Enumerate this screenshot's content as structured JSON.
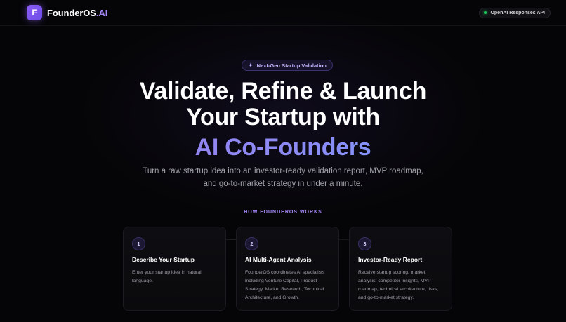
{
  "header": {
    "logo_letter": "F",
    "brand_main": "FounderOS",
    "brand_suffix": ".AI",
    "api_badge": "OpenAI Responses API",
    "status_color": "#22c55e"
  },
  "hero": {
    "pill_label": "Next-Gen Startup Validation",
    "pill_icon": "sparkles-icon",
    "headline_line1": "Validate, Refine & Launch",
    "headline_line2": "Your Startup with",
    "headline_highlight": "AI Co-Founders",
    "subtitle": "Turn a raw startup idea into an investor-ready validation report, MVP roadmap, and go-to-market strategy in under a minute."
  },
  "how_it_works": {
    "label": "HOW FOUNDEROS WORKS",
    "steps": [
      {
        "number": "1",
        "title": "Describe Your Startup",
        "description": "Enter your startup idea in natural language."
      },
      {
        "number": "2",
        "title": "AI Multi-Agent Analysis",
        "description": "FounderOS coordinates AI specialists including Venture Capital, Product Strategy, Market Research, Technical Architecture, and Growth."
      },
      {
        "number": "3",
        "title": "Investor-Ready Report",
        "description": "Receive startup scoring, market analysis, competitor insights, MVP roadmap, technical architecture, risks, and go-to-market strategy."
      }
    ]
  },
  "colors": {
    "accent": "#8b5cf6",
    "accent_light": "#a78bfa",
    "background": "#050507"
  }
}
